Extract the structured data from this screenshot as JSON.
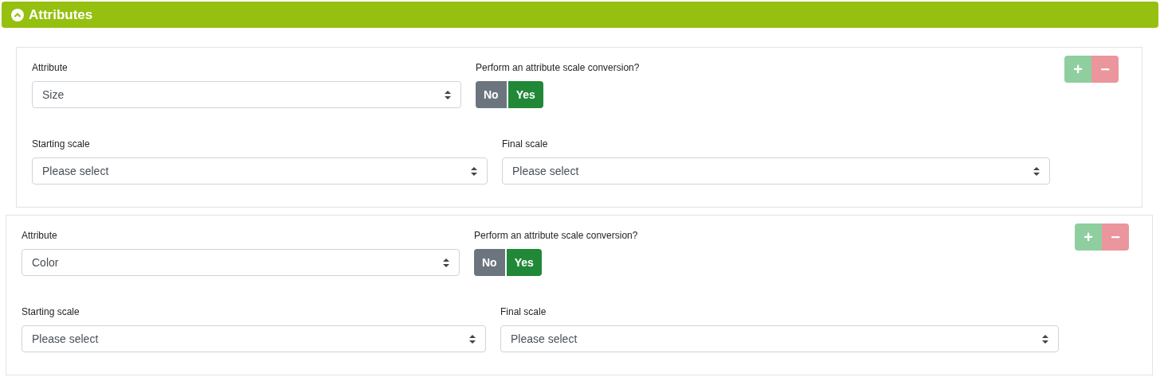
{
  "section": {
    "title": "Attributes",
    "expanded": true
  },
  "rows": [
    {
      "attribute_label": "Attribute",
      "attribute_value": "Size",
      "conversion_label": "Perform an attribute scale conversion?",
      "options": [
        {
          "label": "No",
          "selected": false
        },
        {
          "label": "Yes",
          "selected": true
        }
      ],
      "add": {
        "label": "+",
        "disabled": true
      },
      "remove": {
        "label": "−",
        "disabled": true
      },
      "starting_label": "Starting scale",
      "starting_value": "Please select",
      "final_label": "Final scale",
      "final_value": "Please select"
    },
    {
      "attribute_label": "Attribute",
      "attribute_value": "Color",
      "conversion_label": "Perform an attribute scale conversion?",
      "options": [
        {
          "label": "No",
          "selected": false
        },
        {
          "label": "Yes",
          "selected": true
        }
      ],
      "add": {
        "label": "+",
        "disabled": true
      },
      "remove": {
        "label": "−",
        "disabled": true
      },
      "starting_label": "Starting scale",
      "starting_value": "Please select",
      "final_label": "Final scale",
      "final_value": "Please select"
    }
  ]
}
